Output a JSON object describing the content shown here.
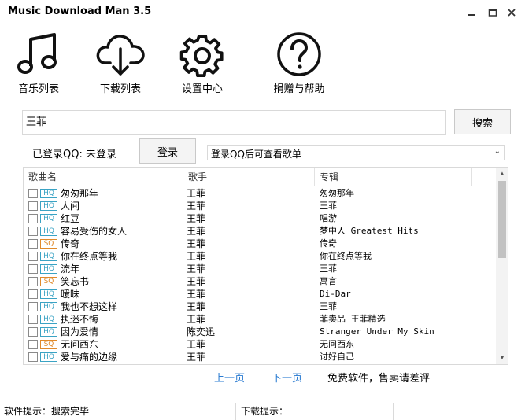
{
  "window": {
    "title": "Music Download Man 3.5"
  },
  "toolbar": [
    {
      "label": "音乐列表",
      "icon": "music-note-icon"
    },
    {
      "label": "下载列表",
      "icon": "cloud-download-icon"
    },
    {
      "label": "设置中心",
      "icon": "gear-icon"
    },
    {
      "label": "捐赠与帮助",
      "icon": "question-icon"
    }
  ],
  "search": {
    "value": "王菲",
    "button_label": "搜索"
  },
  "login": {
    "status_text": "已登录QQ: 未登录",
    "button_label": "登录",
    "playlist_select_value": "登录QQ后可查看歌单"
  },
  "table": {
    "headers": {
      "song": "歌曲名",
      "artist": "歌手",
      "album": "专辑"
    },
    "rows": [
      {
        "quality": "HQ",
        "song": "匆匆那年",
        "artist": "王菲",
        "album": "匆匆那年"
      },
      {
        "quality": "HQ",
        "song": "人间",
        "artist": "王菲",
        "album": "王菲"
      },
      {
        "quality": "HQ",
        "song": "红豆",
        "artist": "王菲",
        "album": "唱游"
      },
      {
        "quality": "HQ",
        "song": "容易受伤的女人",
        "artist": "王菲",
        "album": "梦中人 Greatest Hits"
      },
      {
        "quality": "SQ",
        "song": "传奇",
        "artist": "王菲",
        "album": "传奇"
      },
      {
        "quality": "HQ",
        "song": "你在终点等我",
        "artist": "王菲",
        "album": "你在终点等我"
      },
      {
        "quality": "HQ",
        "song": "流年",
        "artist": "王菲",
        "album": "王菲"
      },
      {
        "quality": "SQ",
        "song": "笑忘书",
        "artist": "王菲",
        "album": "寓言"
      },
      {
        "quality": "HQ",
        "song": "暧昧",
        "artist": "王菲",
        "album": "Di-Dar"
      },
      {
        "quality": "HQ",
        "song": "我也不想这样",
        "artist": "王菲",
        "album": "王菲"
      },
      {
        "quality": "HQ",
        "song": "执迷不悔",
        "artist": "王菲",
        "album": "菲卖品 王菲精选"
      },
      {
        "quality": "HQ",
        "song": "因为爱情",
        "artist": "陈奕迅",
        "album": "Stranger Under My Skin"
      },
      {
        "quality": "SQ",
        "song": "无问西东",
        "artist": "王菲",
        "album": "无问西东"
      },
      {
        "quality": "HQ",
        "song": "爱与痛的边缘",
        "artist": "王菲",
        "album": "讨好自己"
      }
    ]
  },
  "pager": {
    "prev_label": "上一页",
    "next_label": "下一页",
    "promo_text": "免费软件，售卖请差评"
  },
  "statusbar": {
    "software_tip": "软件提示：搜索完毕",
    "download_tip": "下载提示：",
    "extra": ""
  },
  "colors": {
    "link": "#2a7bd1",
    "hq_badge": "#3aa3c4",
    "sq_badge": "#e08a2a"
  }
}
